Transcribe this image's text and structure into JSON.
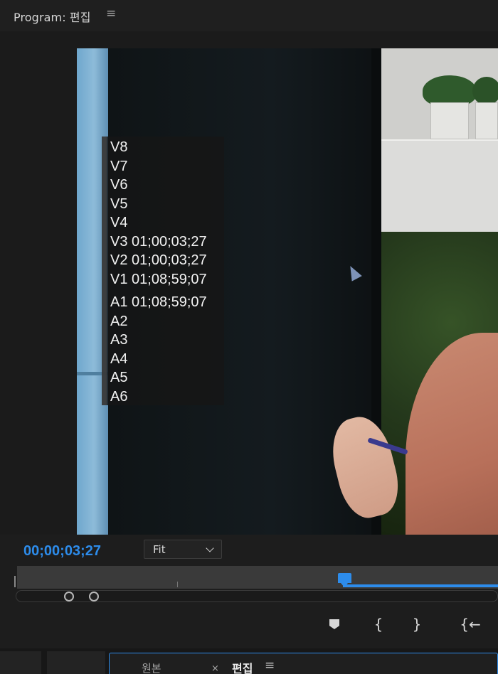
{
  "panel": {
    "title": "Program: 편집",
    "menu_icon": "≡"
  },
  "track_overlay": {
    "tracks": [
      "V8",
      "V7",
      "V6",
      "V5",
      "V4",
      "V3 01;00;03;27",
      "V2 01;00;03;27",
      "V1 01;08;59;07",
      "A1 01;08;59;07",
      "A2",
      "A3",
      "A4",
      "A5",
      "A6"
    ]
  },
  "controls": {
    "timecode": "00;00;03;27",
    "zoom": {
      "selected": "Fit"
    },
    "playhead_position_fraction": 0.68
  },
  "transport": {
    "mark_in": "{",
    "mark_out": "}",
    "go_to_in": "{←"
  },
  "bottom_tabs": {
    "tab1": "원본",
    "close_icon": "×",
    "tab2": "편집",
    "menu_icon": "≡"
  },
  "colors": {
    "accent": "#2d8ceb",
    "background": "#1d1d1d"
  },
  "icons": [
    "panel-menu-icon",
    "add-marker-icon",
    "mark-in-icon",
    "mark-out-icon",
    "go-to-in-icon",
    "close-icon",
    "chevron-down-icon",
    "pointer-cursor-icon"
  ]
}
